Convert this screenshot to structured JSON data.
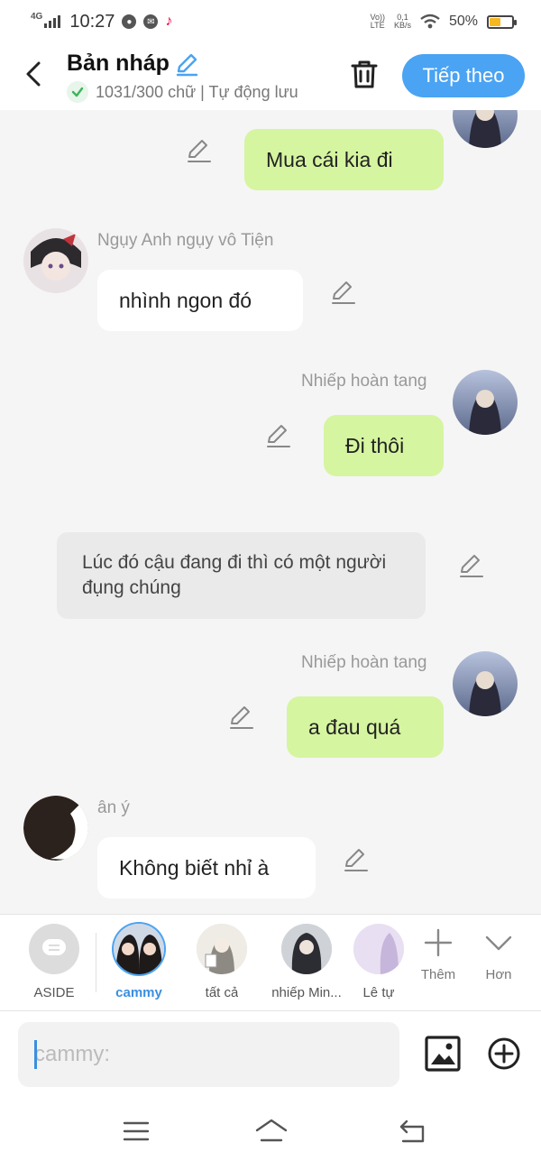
{
  "status_bar": {
    "network": "4G",
    "time": "10:27",
    "volte_top": "Vo))",
    "volte_bottom": "LTE",
    "speed_top": "0,1",
    "speed_bottom": "KB/s",
    "battery": "50%",
    "battery_level": 0.5,
    "battery_color": "#f6b81f"
  },
  "header": {
    "title": "Bản nháp",
    "subtitle": "1031/300 chữ | Tự động lưu",
    "next_label": "Tiếp theo",
    "accent_color": "#4aa3f3"
  },
  "messages": [
    {
      "name": "",
      "text": "Mua cái kia đi"
    },
    {
      "name": "Ngụy Anh ngụy vô Tiện",
      "text": "nhình ngon đó"
    },
    {
      "name": "Nhiếp hoàn tang",
      "text": "Đi thôi"
    },
    {
      "name": "",
      "text": "Lúc đó cậu đang đi thì có một người đụng chúng"
    },
    {
      "name": "Nhiếp hoàn tang",
      "text": "a đau quá"
    },
    {
      "name": "ân ý",
      "text": "Không biết nhỉ à"
    }
  ],
  "characters": [
    {
      "label": "ASIDE",
      "icon": "chat-bubble-icon"
    },
    {
      "label": "cammy",
      "active": true
    },
    {
      "label": "tất cả"
    },
    {
      "label": "nhiếp Min..."
    },
    {
      "label": "Lê tự"
    }
  ],
  "actions": {
    "add_label": "Thêm",
    "more_label": "Hơn"
  },
  "input": {
    "placeholder": "cammy:"
  },
  "colors": {
    "my_bubble": "#d5f5a0",
    "their_bubble": "#ffffff",
    "aside_bubble": "#eaeaea",
    "active_character": "#3a8fe0"
  }
}
